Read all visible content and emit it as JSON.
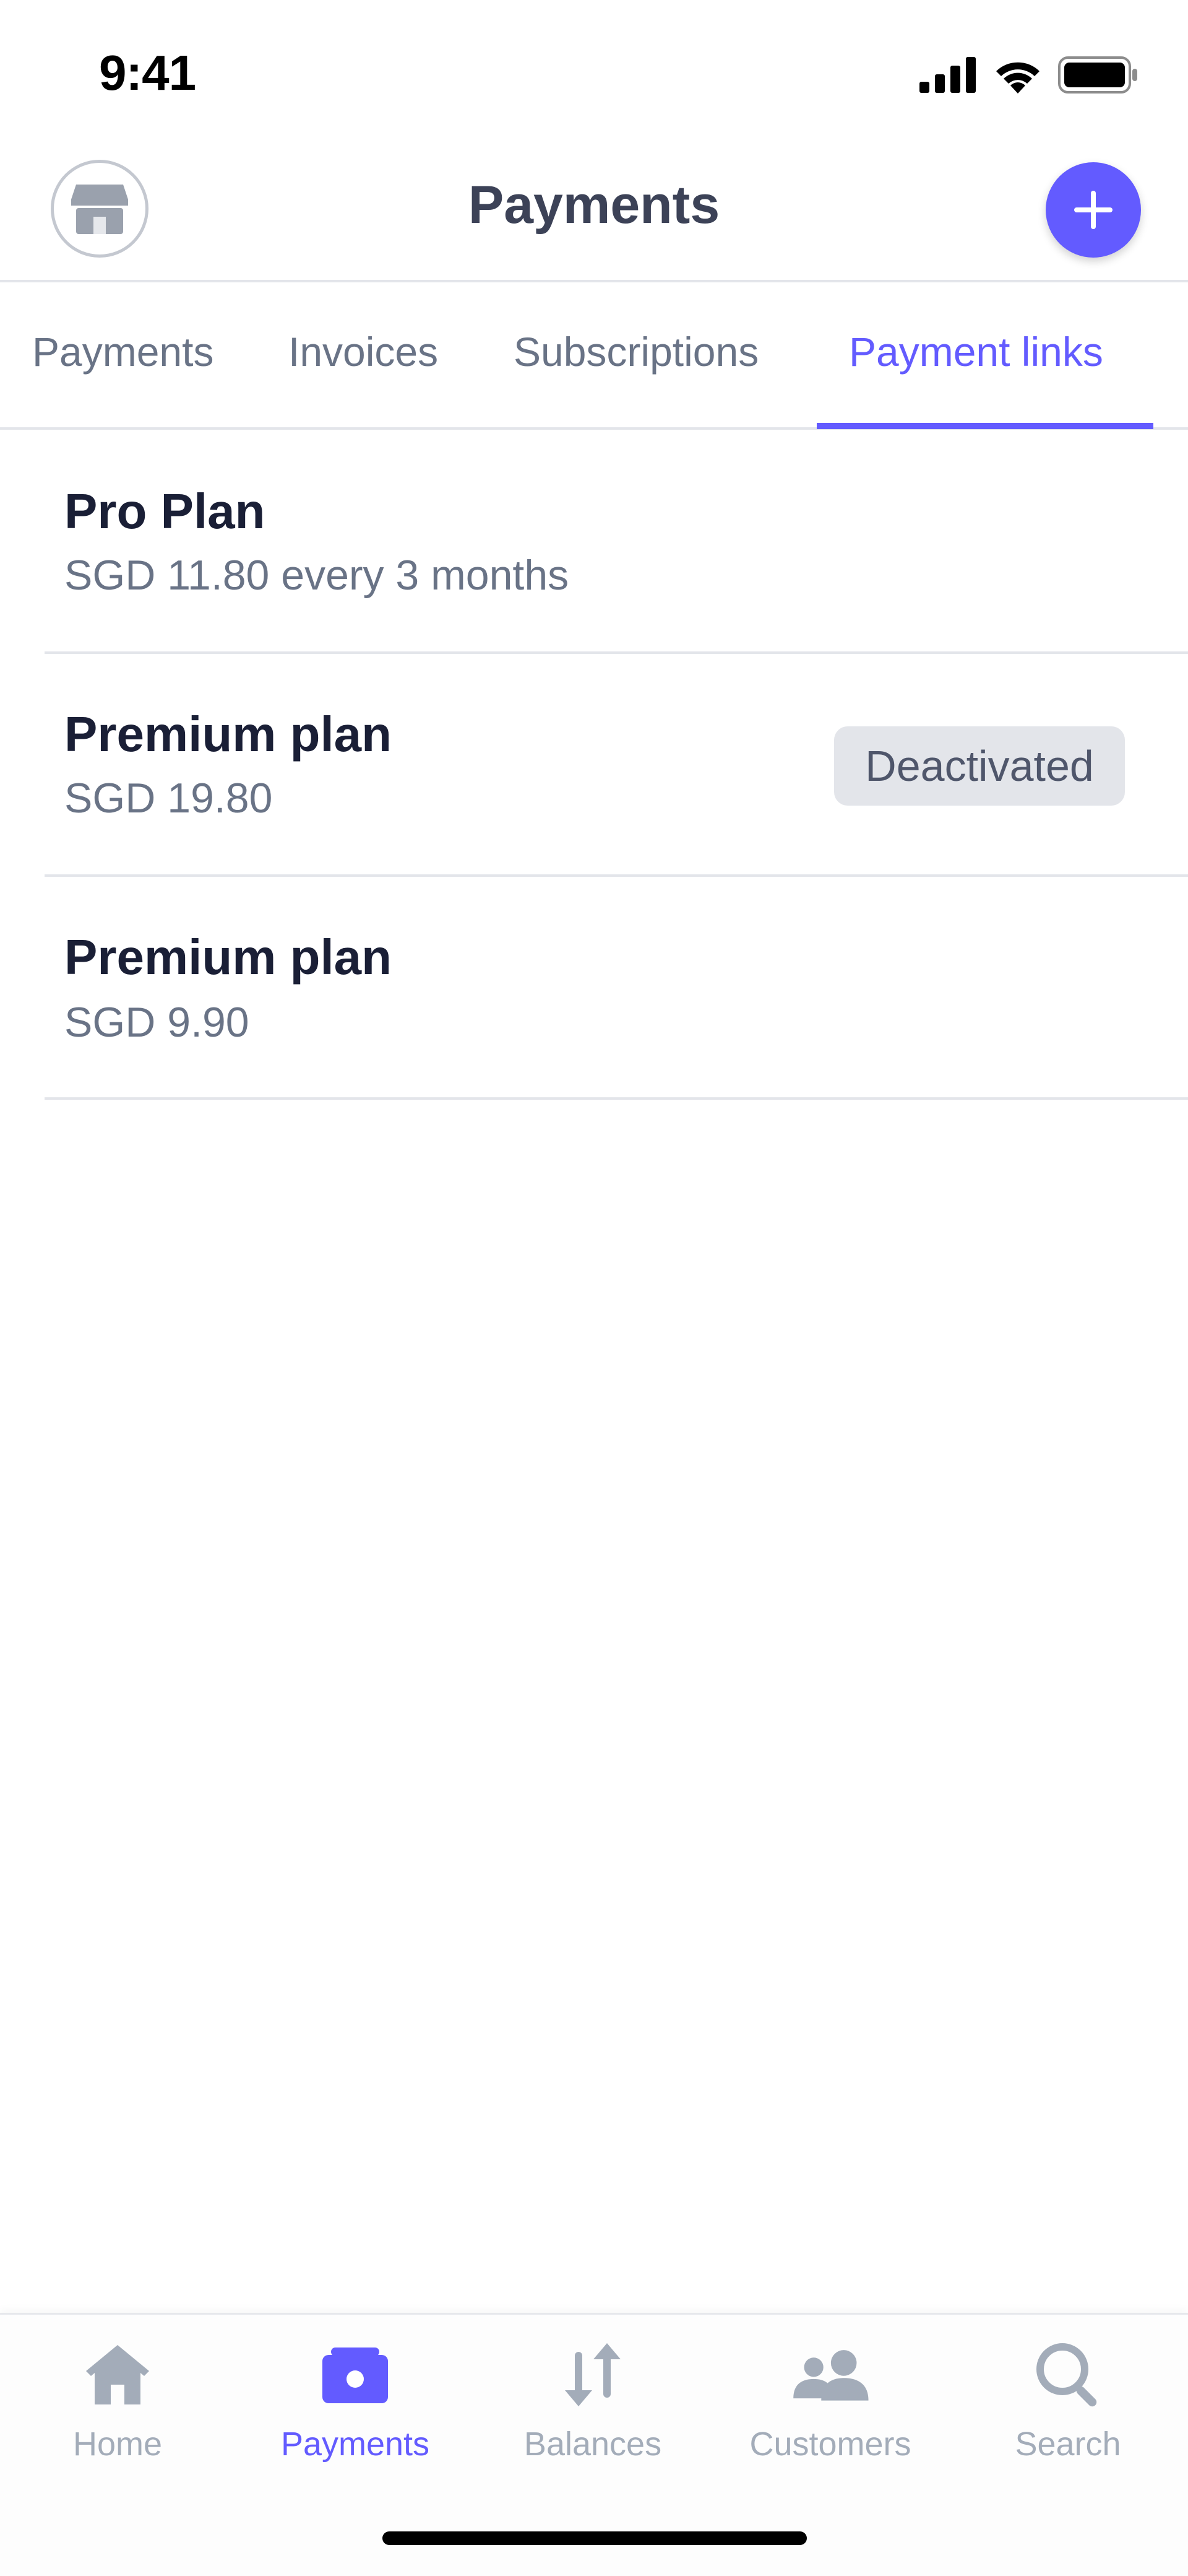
{
  "status_bar": {
    "time": "9:41"
  },
  "header": {
    "title": "Payments",
    "store_icon": "store-icon",
    "add_icon": "plus-icon",
    "accent_color": "#635bff"
  },
  "tabs": [
    {
      "label": "Payments",
      "active": false
    },
    {
      "label": "Invoices",
      "active": false
    },
    {
      "label": "Subscriptions",
      "active": false
    },
    {
      "label": "Payment links",
      "active": true
    }
  ],
  "payment_links": [
    {
      "title": "Pro Plan",
      "subtitle": "SGD 11.80 every 3 months",
      "badge": ""
    },
    {
      "title": "Premium plan",
      "subtitle": "SGD 19.80",
      "badge": "Deactivated"
    },
    {
      "title": "Premium plan",
      "subtitle": "SGD 9.90",
      "badge": ""
    }
  ],
  "tab_bar": [
    {
      "label": "Home",
      "icon": "home-icon",
      "active": false
    },
    {
      "label": "Payments",
      "icon": "payments-icon",
      "active": true
    },
    {
      "label": "Balances",
      "icon": "balances-icon",
      "active": false
    },
    {
      "label": "Customers",
      "icon": "customers-icon",
      "active": false
    },
    {
      "label": "Search",
      "icon": "search-icon",
      "active": false
    }
  ]
}
